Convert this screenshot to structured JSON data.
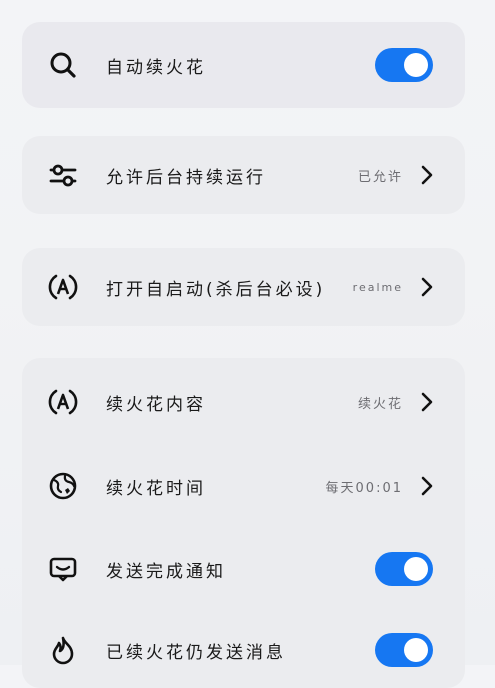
{
  "colors": {
    "accent": "#1677f2",
    "card": "#ebecef",
    "text": "#1a1a1a",
    "secondary_text": "#6d6d72"
  },
  "rows": [
    {
      "label": "自动续火花",
      "icon": "search-icon",
      "control": "toggle",
      "toggle_on": true
    },
    {
      "label": "允许后台持续运行",
      "icon": "sliders-icon",
      "value": "已允许",
      "control": "chevron"
    },
    {
      "label": "打开自启动(杀后台必设)",
      "icon": "autostart-a-icon",
      "value": "realme",
      "control": "chevron"
    },
    {
      "label": "续火花内容",
      "icon": "content-a-icon",
      "value": "续火花",
      "control": "chevron"
    },
    {
      "label": "续火花时间",
      "icon": "globe-clock-icon",
      "value": "每天00:01",
      "control": "chevron"
    },
    {
      "label": "发送完成通知",
      "icon": "notification-icon",
      "control": "toggle",
      "toggle_on": true
    },
    {
      "label": "已续火花仍发送消息",
      "icon": "flame-icon",
      "control": "toggle",
      "toggle_on": true
    }
  ]
}
